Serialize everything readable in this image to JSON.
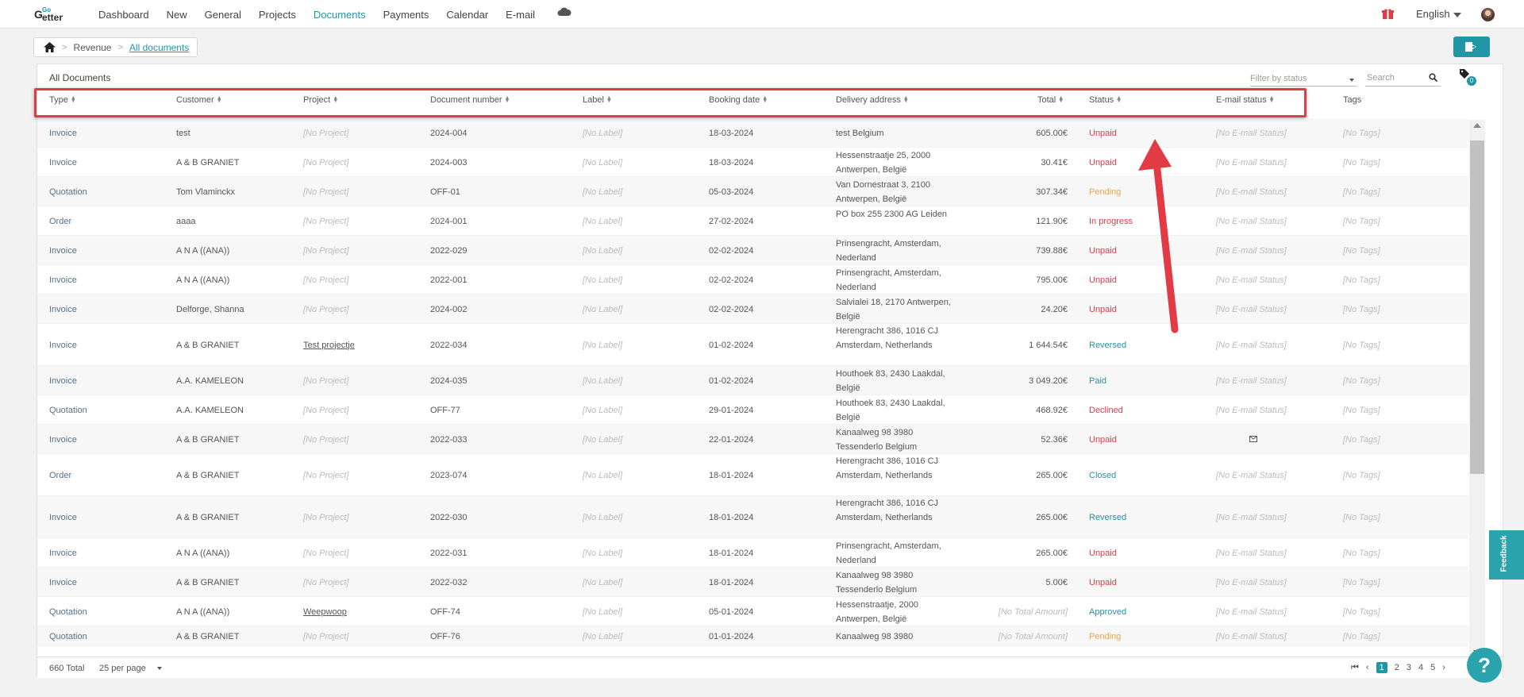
{
  "nav": {
    "items": [
      {
        "label": "Dashboard",
        "active": false
      },
      {
        "label": "New",
        "active": false
      },
      {
        "label": "General",
        "active": false
      },
      {
        "label": "Projects",
        "active": false
      },
      {
        "label": "Documents",
        "active": true
      },
      {
        "label": "Payments",
        "active": false
      },
      {
        "label": "Calendar",
        "active": false
      },
      {
        "label": "E-mail",
        "active": false
      }
    ],
    "language": "English"
  },
  "breadcrumb": {
    "first": "Revenue",
    "current": "All documents"
  },
  "panel": {
    "title": "All Documents",
    "filter_placeholder": "Filter by status",
    "search_placeholder": "Search",
    "tag_count": "0"
  },
  "columns": {
    "type": "Type",
    "customer": "Customer",
    "project": "Project",
    "docnum": "Document number",
    "label": "Label",
    "date": "Booking date",
    "address": "Delivery address",
    "total": "Total",
    "status": "Status",
    "email": "E-mail status",
    "tags": "Tags"
  },
  "rows": [
    {
      "type": "Invoice",
      "customer": "test",
      "project": "[No Project]",
      "doc": "2024-004",
      "label": "[No Label]",
      "date": "18-03-2024",
      "address": "test Belgium",
      "total": "605.00€",
      "status": "Unpaid",
      "status_color": "#e23b45",
      "email": "[No E-mail Status]",
      "tags": "[No Tags]"
    },
    {
      "type": "Invoice",
      "customer": "A & B GRANIET",
      "project": "[No Project]",
      "doc": "2024-003",
      "label": "[No Label]",
      "date": "18-03-2024",
      "address": "Hessenstraatje 25, 2000 Antwerpen, België",
      "total": "30.41€",
      "status": "Unpaid",
      "status_color": "#e23b45",
      "email": "[No E-mail Status]",
      "tags": "[No Tags]"
    },
    {
      "type": "Quotation",
      "customer": "Tom Vlaminckx",
      "project": "[No Project]",
      "doc": "OFF-01",
      "label": "[No Label]",
      "date": "05-03-2024",
      "address": "Van Dornestraat 3, 2100 Antwerpen, België",
      "total": "307.34€",
      "status": "Pending",
      "status_color": "#f2a24a",
      "email": "[No E-mail Status]",
      "tags": "[No Tags]"
    },
    {
      "type": "Order",
      "customer": "aaaa",
      "project": "[No Project]",
      "doc": "2024-001",
      "label": "[No Label]",
      "date": "27-02-2024",
      "address": "PO box 255 2300 AG Leiden",
      "total": "121.90€",
      "status": "In progress",
      "status_color": "#e23b45",
      "email": "[No E-mail Status]",
      "tags": "[No Tags]"
    },
    {
      "type": "Invoice",
      "customer": "A N A ((ANA))",
      "project": "[No Project]",
      "doc": "2022-029",
      "label": "[No Label]",
      "date": "02-02-2024",
      "address": "Prinsengracht, Amsterdam, Nederland",
      "total": "739.88€",
      "status": "Unpaid",
      "status_color": "#e23b45",
      "email": "[No E-mail Status]",
      "tags": "[No Tags]"
    },
    {
      "type": "Invoice",
      "customer": "A N A ((ANA))",
      "project": "[No Project]",
      "doc": "2022-001",
      "label": "[No Label]",
      "date": "02-02-2024",
      "address": "Prinsengracht, Amsterdam, Nederland",
      "total": "795.00€",
      "status": "Unpaid",
      "status_color": "#e23b45",
      "email": "[No E-mail Status]",
      "tags": "[No Tags]"
    },
    {
      "type": "Invoice",
      "customer": "Delforge, Shanna",
      "project": "[No Project]",
      "doc": "2024-002",
      "label": "[No Label]",
      "date": "02-02-2024",
      "address": "Salvialei 18, 2170 Antwerpen, België",
      "total": "24.20€",
      "status": "Unpaid",
      "status_color": "#e23b45",
      "email": "[No E-mail Status]",
      "tags": "[No Tags]"
    },
    {
      "type": "Invoice",
      "customer": "A & B GRANIET",
      "project": "Test projectje",
      "project_link": true,
      "doc": "2022-034",
      "label": "[No Label]",
      "date": "01-02-2024",
      "address": "Herengracht 386, 1016 CJ Amsterdam, Netherlands",
      "total": "1 644.54€",
      "status": "Reversed",
      "status_color": "#2a8fa0",
      "email": "[No E-mail Status]",
      "tags": "[No Tags]"
    },
    {
      "type": "Invoice",
      "customer": "A.A. KAMELEON",
      "project": "[No Project]",
      "doc": "2024-035",
      "label": "[No Label]",
      "date": "01-02-2024",
      "address": "Houthoek 83, 2430 Laakdal, België",
      "total": "3 049.20€",
      "status": "Paid",
      "status_color": "#2a8fa0",
      "email": "[No E-mail Status]",
      "tags": "[No Tags]"
    },
    {
      "type": "Quotation",
      "customer": "A.A. KAMELEON",
      "project": "[No Project]",
      "doc": "OFF-77",
      "label": "[No Label]",
      "date": "29-01-2024",
      "address": "Houthoek 83, 2430 Laakdal, België",
      "total": "468.92€",
      "status": "Declined",
      "status_color": "#e23b45",
      "email": "[No E-mail Status]",
      "tags": "[No Tags]"
    },
    {
      "type": "Invoice",
      "customer": "A & B GRANIET",
      "project": "[No Project]",
      "doc": "2022-033",
      "label": "[No Label]",
      "date": "22-01-2024",
      "address": "Kanaalweg 98 3980 Tessenderlo Belgium",
      "total": "52.36€",
      "status": "Unpaid",
      "status_color": "#e23b45",
      "email": "",
      "email_icon": "envelope-icon",
      "tags": "[No Tags]"
    },
    {
      "type": "Order",
      "customer": "A & B GRANIET",
      "project": "[No Project]",
      "doc": "2023-074",
      "label": "[No Label]",
      "date": "18-01-2024",
      "address": "Herengracht 386, 1016 CJ Amsterdam, Netherlands",
      "total": "265.00€",
      "status": "Closed",
      "status_color": "#2a8fa0",
      "email": "[No E-mail Status]",
      "tags": "[No Tags]"
    },
    {
      "type": "Invoice",
      "customer": "A & B GRANIET",
      "project": "[No Project]",
      "doc": "2022-030",
      "label": "[No Label]",
      "date": "18-01-2024",
      "address": "Herengracht 386, 1016 CJ Amsterdam, Netherlands",
      "total": "265.00€",
      "status": "Reversed",
      "status_color": "#2a8fa0",
      "email": "[No E-mail Status]",
      "tags": "[No Tags]"
    },
    {
      "type": "Invoice",
      "customer": "A N A ((ANA))",
      "project": "[No Project]",
      "doc": "2022-031",
      "label": "[No Label]",
      "date": "18-01-2024",
      "address": "Prinsengracht, Amsterdam, Nederland",
      "total": "265.00€",
      "status": "Unpaid",
      "status_color": "#e23b45",
      "email": "[No E-mail Status]",
      "tags": "[No Tags]"
    },
    {
      "type": "Invoice",
      "customer": "A & B GRANIET",
      "project": "[No Project]",
      "doc": "2022-032",
      "label": "[No Label]",
      "date": "18-01-2024",
      "address": "Kanaalweg 98 3980 Tessenderlo Belgium",
      "total": "5.00€",
      "status": "Unpaid",
      "status_color": "#e23b45",
      "email": "[No E-mail Status]",
      "tags": "[No Tags]"
    },
    {
      "type": "Quotation",
      "customer": "A N A ((ANA))",
      "project": "Weepwoop",
      "project_link": true,
      "doc": "OFF-74",
      "label": "[No Label]",
      "date": "05-01-2024",
      "address": "Hessenstraatje, 2000 Antwerpen, België",
      "total": "[No Total Amount]",
      "total_none": true,
      "status": "Approved",
      "status_color": "#2a8fa0",
      "email": "[No E-mail Status]",
      "tags": "[No Tags]"
    },
    {
      "type": "Quotation",
      "customer": "A & B GRANIET",
      "project": "[No Project]",
      "doc": "OFF-76",
      "label": "[No Label]",
      "date": "01-01-2024",
      "address": "Kanaalweg 98 3980",
      "total": "[No Total Amount]",
      "total_none": true,
      "status": "Pending",
      "status_color": "#f2a24a",
      "email": "[No E-mail Status]",
      "tags": "[No Tags]"
    }
  ],
  "footer": {
    "total": "660 Total",
    "per_page": "25 per page",
    "pages": [
      "1",
      "2",
      "3",
      "4",
      "5"
    ],
    "current_page": "1"
  },
  "feedback_label": "Feedback",
  "help_label": "?"
}
